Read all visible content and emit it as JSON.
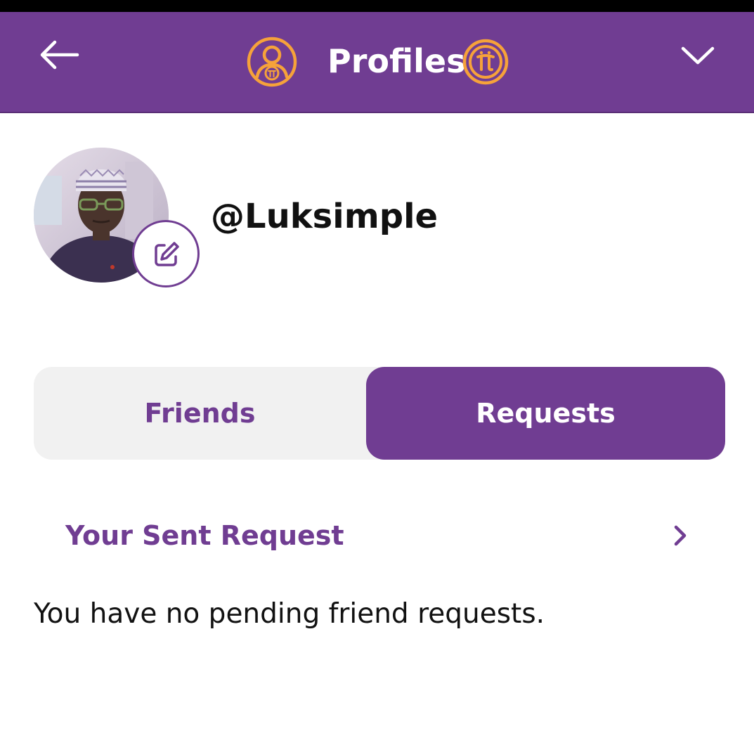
{
  "header": {
    "title": "Profiles",
    "background_color": "#703d92",
    "badge_color": "#f6a23a",
    "icons": [
      "back-arrow-icon",
      "profile-pi-icon",
      "pi-coin-icon",
      "chevron-down-icon"
    ]
  },
  "profile": {
    "username": "@Luksimple",
    "avatar": "user-profile-photo",
    "edit_icon": "edit-pencil-icon"
  },
  "tabs": [
    {
      "label": "Friends",
      "active": false
    },
    {
      "label": "Requests",
      "active": true
    }
  ],
  "requests": {
    "sent_request_label": "Your Sent Request",
    "chevron_icon": "chevron-right-icon",
    "empty_message": "You have no pending friend requests."
  },
  "colors": {
    "accent": "#703d92",
    "inactive_tab_bg": "#f1f1f1",
    "text": "#111111"
  }
}
